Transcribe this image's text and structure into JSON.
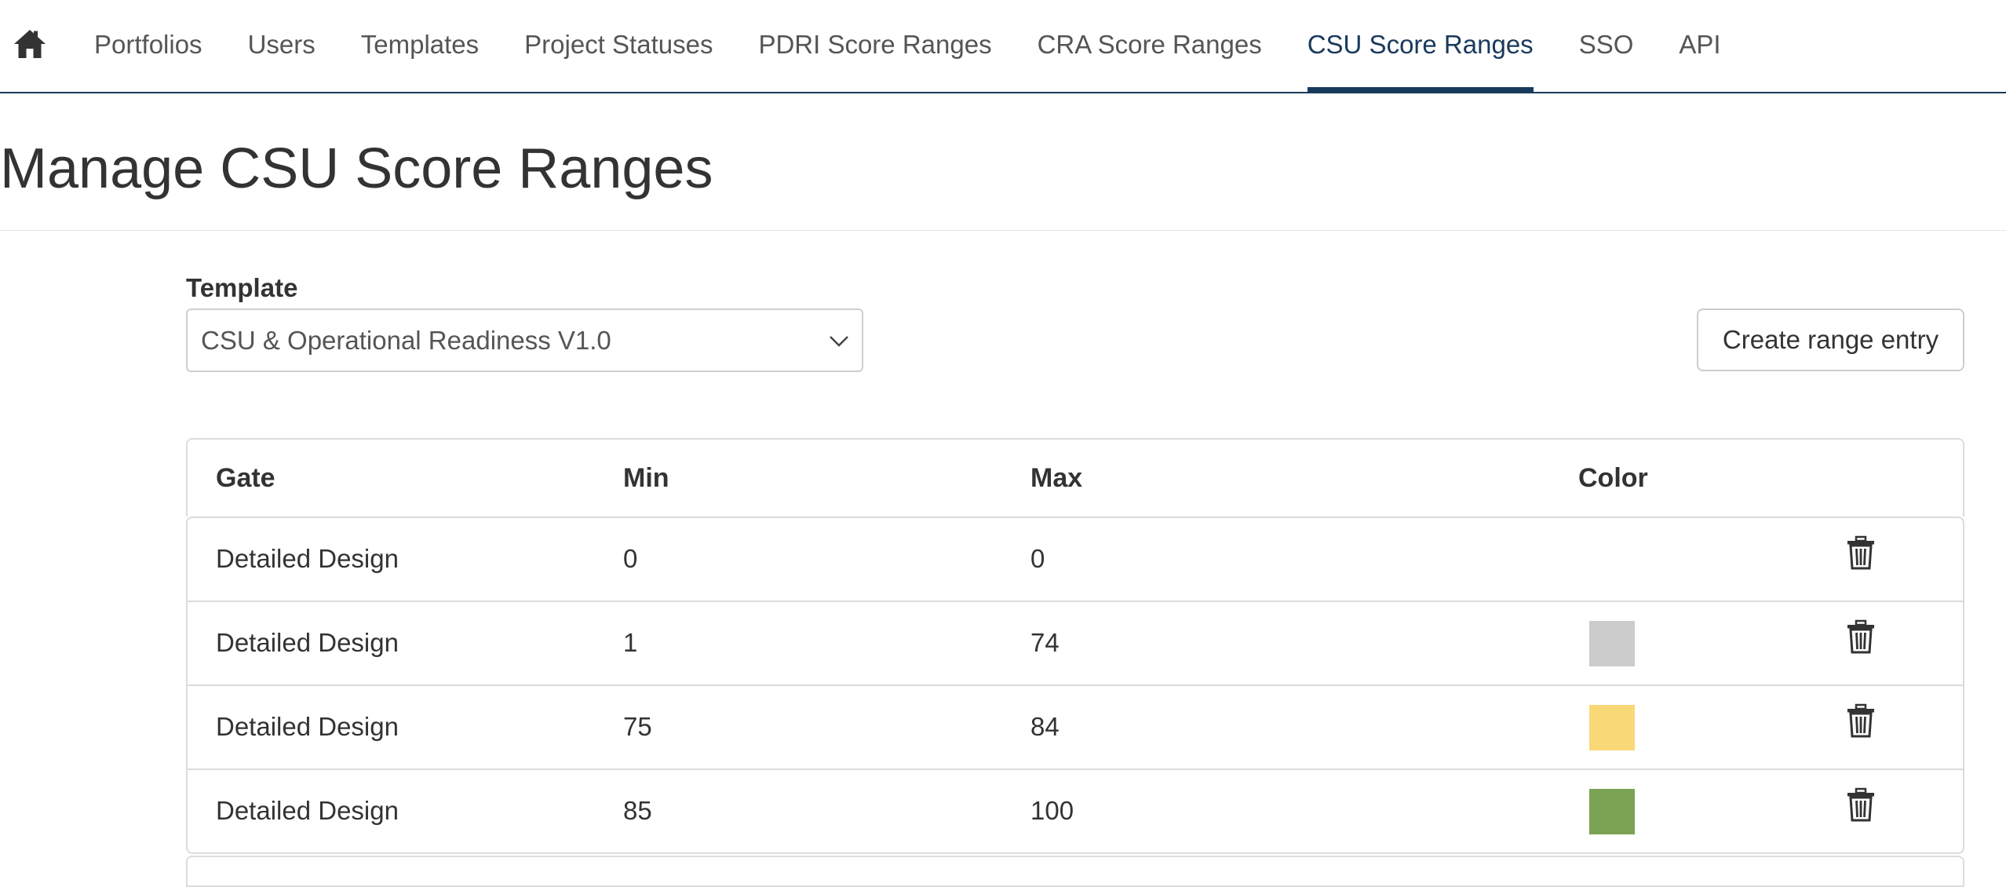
{
  "nav": {
    "home_icon": "home-icon",
    "items": [
      {
        "label": "Portfolios",
        "active": false
      },
      {
        "label": "Users",
        "active": false
      },
      {
        "label": "Templates",
        "active": false
      },
      {
        "label": "Project Statuses",
        "active": false
      },
      {
        "label": "PDRI Score Ranges",
        "active": false
      },
      {
        "label": "CRA Score Ranges",
        "active": false
      },
      {
        "label": "CSU Score Ranges",
        "active": true
      },
      {
        "label": "SSO",
        "active": false
      },
      {
        "label": "API",
        "active": false
      }
    ]
  },
  "page": {
    "title": "Manage CSU Score Ranges"
  },
  "template": {
    "label": "Template",
    "selected": "CSU & Operational Readiness V1.0",
    "chevron_icon": "chevron-down-icon"
  },
  "actions": {
    "create_label": "Create range entry"
  },
  "table": {
    "headers": {
      "gate": "Gate",
      "min": "Min",
      "max": "Max",
      "color": "Color"
    },
    "rows": [
      {
        "gate": "Detailed Design",
        "min": "0",
        "max": "0",
        "color": null
      },
      {
        "gate": "Detailed Design",
        "min": "1",
        "max": "74",
        "color": "#cccccc"
      },
      {
        "gate": "Detailed Design",
        "min": "75",
        "max": "84",
        "color": "#f9d878"
      },
      {
        "gate": "Detailed Design",
        "min": "85",
        "max": "100",
        "color": "#7aa354"
      }
    ],
    "delete_icon": "trash-icon"
  },
  "colors": {
    "accent": "#1a3a5c",
    "text": "#333333",
    "muted_text": "#555555",
    "border": "#dcdcdc"
  }
}
